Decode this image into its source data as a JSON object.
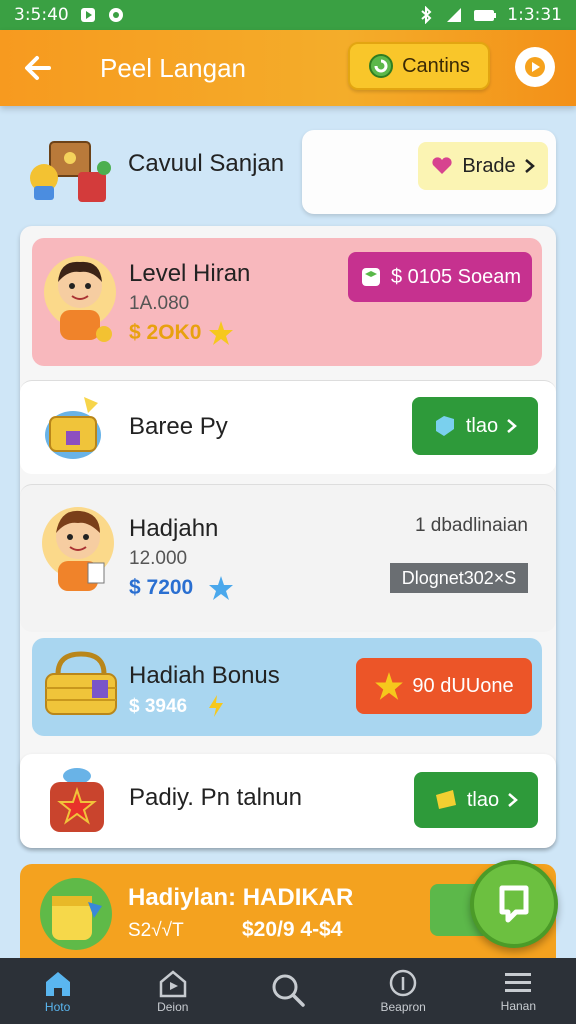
{
  "status": {
    "time_left": "3:5:40",
    "time_right": "1:3:31"
  },
  "header": {
    "title": "Peel Langan",
    "coins_label": "Cantins"
  },
  "promo": {
    "title": "Cavuul Sanjan",
    "button_label": "Brade"
  },
  "levels": {
    "first": {
      "title": "Level Hiran",
      "sub": "1A.080",
      "amount": "$ 2OK0",
      "button_label": "$ 0105 Soeam"
    },
    "barrel": {
      "title": "Baree Py",
      "button_label": "tlao"
    },
    "second": {
      "title": "Hadjahn",
      "sub": "12.000",
      "amount": "$ 7200",
      "right_text": "1 dbadlinaian",
      "tag": "Dlognet302×S"
    },
    "bonus": {
      "title": "Hadiah Bonus",
      "amount": "$ 3946",
      "button_label": "90 dUUone"
    },
    "padiy": {
      "title": "Padiy. Pn talnun",
      "button_label": "tlao"
    },
    "last": {
      "title": "Hadiylan: HADIKAR",
      "sub": "S2√√T",
      "amount": "$20/9 4-$4"
    }
  },
  "nav": {
    "items": [
      {
        "label": "Hoto",
        "icon": "home-icon"
      },
      {
        "label": "Deion",
        "icon": "house-icon"
      },
      {
        "label": "",
        "icon": "search-icon"
      },
      {
        "label": "Beapron",
        "icon": "info-icon"
      },
      {
        "label": "Hanan",
        "icon": "menu-icon"
      }
    ]
  },
  "colors": {
    "appbar": "#f39a1f",
    "statusbar": "#3aa043",
    "accent_green": "#2e9a3a",
    "pink": "#f8b7bd",
    "blue": "#a9d6f0"
  }
}
